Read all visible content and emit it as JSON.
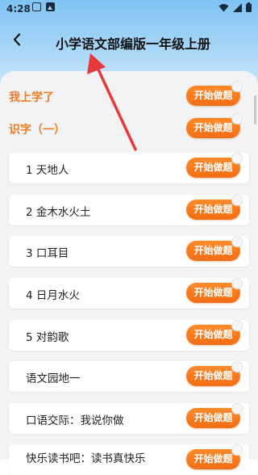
{
  "status_bar": {
    "time": "4:28"
  },
  "header": {
    "title": "小学语文部编版一年级上册"
  },
  "sections": [
    {
      "label": "我上学了",
      "button": "开始做题"
    },
    {
      "label": "识字（一）",
      "button": "开始做题"
    }
  ],
  "lessons": [
    {
      "label": "1 天地人",
      "button": "开始做题"
    },
    {
      "label": "2 金木水火土",
      "button": "开始做题"
    },
    {
      "label": "3 口耳目",
      "button": "开始做题"
    },
    {
      "label": "4 日月水火",
      "button": "开始做题"
    },
    {
      "label": "5 对韵歌",
      "button": "开始做题"
    },
    {
      "label": "语文园地一",
      "button": "开始做题"
    },
    {
      "label": "口语交际：我说你做",
      "button": "开始做题"
    },
    {
      "label": "快乐读书吧：读书真快乐",
      "button": "开始做题"
    }
  ],
  "colors": {
    "accent": "#f27b20",
    "annotation_arrow": "#e8393a"
  }
}
